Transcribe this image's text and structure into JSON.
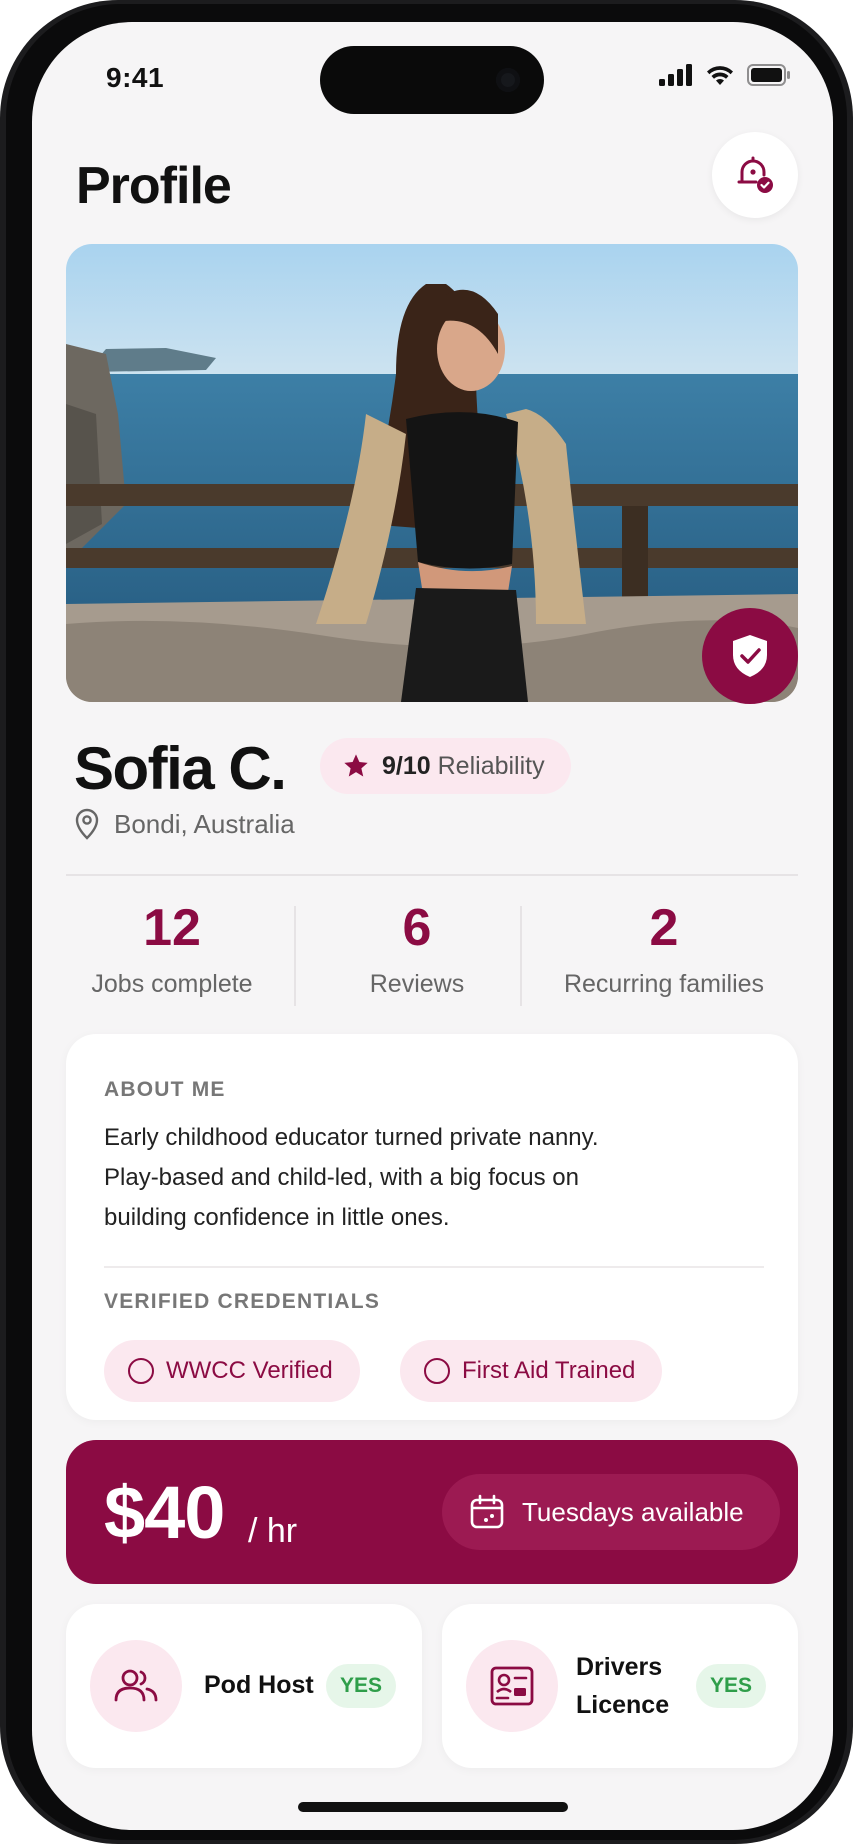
{
  "status_bar": {
    "time": "9:41"
  },
  "header": {
    "title": "Profile"
  },
  "profile": {
    "name": "Sofia C.",
    "reliability_score": "9/10",
    "reliability_label": "Reliability",
    "location": "Bondi, Australia"
  },
  "stats": [
    {
      "value": "12",
      "label": "Jobs complete"
    },
    {
      "value": "6",
      "label": "Reviews"
    },
    {
      "value": "2",
      "label": "Recurring families"
    }
  ],
  "about": {
    "heading": "ABOUT ME",
    "lines": [
      "Early childhood educator turned private nanny.",
      "Play-based and child-led, with a big focus on",
      "building confidence in little ones."
    ]
  },
  "credentials": {
    "heading": "VERIFIED CREDENTIALS",
    "items": [
      "WWCC Verified",
      "First Aid Trained"
    ]
  },
  "rate": {
    "amount": "$40",
    "unit": "/ hr",
    "availability": "Tuesdays available"
  },
  "features": [
    {
      "label": "Pod Host",
      "value": "YES",
      "icon": "people-icon"
    },
    {
      "label_line1": "Drivers",
      "label_line2": "Licence",
      "value": "YES",
      "icon": "id-card-icon"
    }
  ],
  "colors": {
    "brand": "#8b0b43",
    "brand_soft": "#fbe8ef",
    "success": "#2f9e4a",
    "success_soft": "#e6f6e9"
  }
}
